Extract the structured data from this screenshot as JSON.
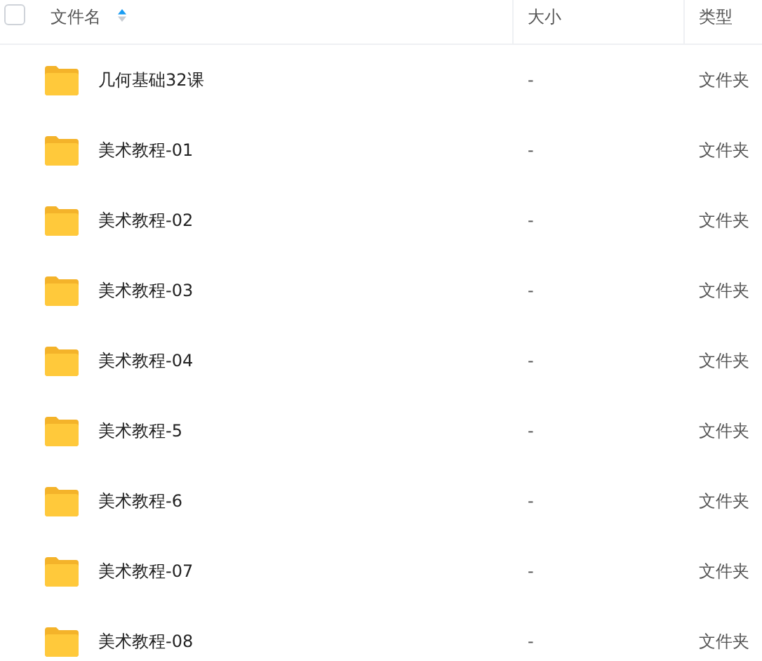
{
  "table": {
    "select_all": {
      "checked": false
    },
    "columns": [
      {
        "label": "文件名",
        "sorted": true
      },
      {
        "label": "大小",
        "sorted": false
      },
      {
        "label": "类型",
        "sorted": false
      }
    ],
    "rows": [
      {
        "name": "几何基础32课",
        "size": "-",
        "type": "文件夹"
      },
      {
        "name": "美术教程-01",
        "size": "-",
        "type": "文件夹"
      },
      {
        "name": "美术教程-02",
        "size": "-",
        "type": "文件夹"
      },
      {
        "name": "美术教程-03",
        "size": "-",
        "type": "文件夹"
      },
      {
        "name": "美术教程-04",
        "size": "-",
        "type": "文件夹"
      },
      {
        "name": "美术教程-5",
        "size": "-",
        "type": "文件夹"
      },
      {
        "name": "美术教程-6",
        "size": "-",
        "type": "文件夹"
      },
      {
        "name": "美术教程-07",
        "size": "-",
        "type": "文件夹"
      },
      {
        "name": "美术教程-08",
        "size": "-",
        "type": "文件夹"
      }
    ]
  }
}
